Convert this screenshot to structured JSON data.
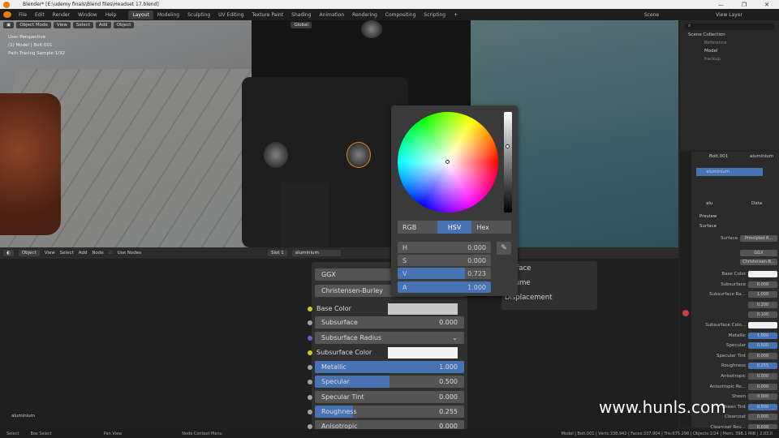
{
  "window": {
    "title": "Blender* [E:\\udemy finals\\Blend files\\Headset 17.blend]",
    "controls": [
      "—",
      "❐",
      "✕"
    ]
  },
  "menus": [
    "File",
    "Edit",
    "Render",
    "Window",
    "Help"
  ],
  "workspaces": [
    {
      "label": "Layout",
      "active": true
    },
    {
      "label": "Modeling"
    },
    {
      "label": "Sculpting"
    },
    {
      "label": "UV Editing"
    },
    {
      "label": "Texture Paint"
    },
    {
      "label": "Shading"
    },
    {
      "label": "Animation"
    },
    {
      "label": "Rendering"
    },
    {
      "label": "Compositing"
    },
    {
      "label": "Scripting"
    }
  ],
  "scene": "Scene",
  "view_layer": "View Layer",
  "viewport": {
    "mode": "Object Mode",
    "menu": [
      "View",
      "Select",
      "Add",
      "Object"
    ],
    "transform": "Global",
    "info": [
      "User Perspective",
      "(1) Model | Bolt.001",
      "Path Tracing Sample 1/32"
    ]
  },
  "picker": {
    "modes": [
      "RGB",
      "HSV",
      "Hex"
    ],
    "active": "HSV",
    "fields": [
      {
        "label": "H",
        "value": "0.000"
      },
      {
        "label": "S",
        "value": "0.000"
      },
      {
        "label": "V",
        "value": "0.723"
      },
      {
        "label": "A",
        "value": "1.000"
      }
    ]
  },
  "nodeeditor": {
    "object": "Object",
    "menu": [
      "View",
      "Select",
      "Add",
      "Node"
    ],
    "use_nodes": "Use Nodes",
    "slot": "Slot 1",
    "material": "aluminium",
    "label": "aluminium"
  },
  "bsdf": {
    "distribution": "GGX",
    "subsurface_method": "Christensen-Burley",
    "rows": [
      {
        "label": "Base Color",
        "type": "color",
        "color": "#c8c8c8"
      },
      {
        "label": "Subsurface",
        "value": "0.000"
      },
      {
        "label": "Subsurface Radius",
        "type": "dropdown"
      },
      {
        "label": "Subsurface Color",
        "type": "color",
        "color": "#f4f4f4"
      },
      {
        "label": "Metallic",
        "value": "1.000",
        "fill": 1.0
      },
      {
        "label": "Specular",
        "value": "0.500",
        "fill": 0.5
      },
      {
        "label": "Specular Tint",
        "value": "0.000"
      },
      {
        "label": "Roughness",
        "value": "0.255",
        "fill": 0.255
      },
      {
        "label": "Anisotropic",
        "value": "0.000"
      }
    ]
  },
  "outputs": [
    "Surface",
    "Volume",
    "Displacement"
  ],
  "outliner": {
    "title": "Scene Collection",
    "items": [
      "Reference",
      "Model",
      "backup"
    ]
  },
  "properties": {
    "object": "Bolt.001",
    "material": "aluminium",
    "slot_item": "aluminium",
    "mat_field": "alu",
    "data": "Data",
    "sections": [
      "Preview",
      "Surface"
    ],
    "surface": "Principled B...",
    "dist": "GGX",
    "sss": "Christensen-B...",
    "rows": [
      {
        "label": "Base Color",
        "value": "",
        "style": "white"
      },
      {
        "label": "Subsurface",
        "value": "0.000"
      },
      {
        "label": "Subsurface Ra...",
        "value": "1.000"
      },
      {
        "label": "",
        "value": "0.200"
      },
      {
        "label": "",
        "value": "0.100"
      },
      {
        "label": "Subsurface Colo...",
        "value": "",
        "style": "white"
      },
      {
        "label": "Metallic",
        "value": "1.000",
        "style": "blue"
      },
      {
        "label": "Specular",
        "value": "0.500",
        "style": "blue"
      },
      {
        "label": "Specular Tint",
        "value": "0.000"
      },
      {
        "label": "Roughness",
        "value": "0.255",
        "style": "blue"
      },
      {
        "label": "Anisotropic",
        "value": "0.000"
      },
      {
        "label": "Anisotropic Ro...",
        "value": "0.000"
      },
      {
        "label": "Sheen",
        "value": "0.000"
      },
      {
        "label": "Sheen Tint",
        "value": "0.500",
        "style": "blue"
      },
      {
        "label": "Clearcoat",
        "value": "0.000"
      },
      {
        "label": "Clearcoat Rou...",
        "value": "0.030"
      }
    ]
  },
  "status": {
    "left": [
      "Select",
      "Box Select",
      "Pan View",
      "Node Context Menu"
    ],
    "right": "Model | Bolt.001 | Verts:338,942 | Faces:337,904 | Tris:675,298 | Objects:1/24 | Mem: 398.1 MiB | 2.83.0"
  },
  "watermark": "www.hunls.com"
}
